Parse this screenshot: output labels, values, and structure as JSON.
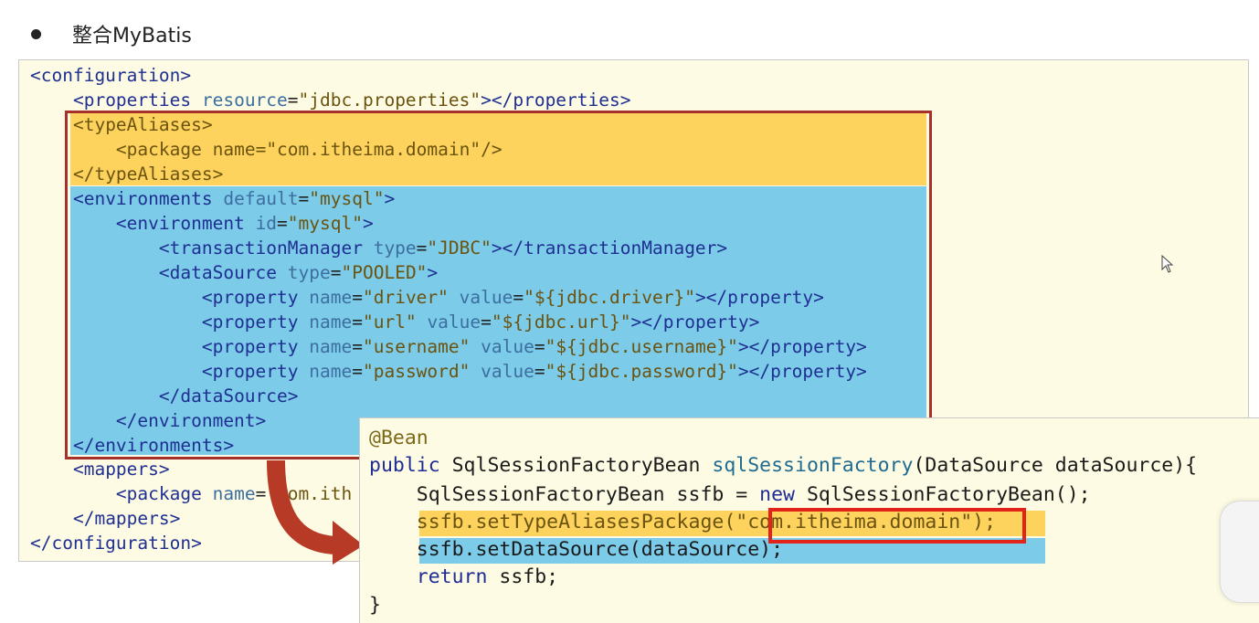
{
  "heading": {
    "text": "整合MyBatis"
  },
  "xml": {
    "config_open": "<configuration>",
    "properties_open": "<properties",
    "properties_attr": "resource",
    "properties_val": "\"jdbc.properties\"",
    "properties_close": "></properties>",
    "typealiases_open": "<typeAliases>",
    "package1_open": "<package",
    "package1_attr": "name",
    "package1_val": "\"com.itheima.domain\"",
    "package1_close": "/>",
    "typealiases_close": "</typeAliases>",
    "envs_open": "<environments",
    "envs_attr": "default",
    "envs_val": "\"mysql\"",
    "envs_close": ">",
    "env_open": "<environment",
    "env_attr": "id",
    "env_val": "\"mysql\"",
    "env_close": ">",
    "tm_open": "<transactionManager",
    "tm_attr": "type",
    "tm_val": "\"JDBC\"",
    "tm_close": "></transactionManager>",
    "ds_open": "<dataSource",
    "ds_attr": "type",
    "ds_val": "\"POOLED\"",
    "ds_close": ">",
    "properties_list": [
      {
        "open": "<property",
        "n": "name",
        "nv": "\"driver\"",
        "v": "value",
        "vv": "\"${jdbc.driver}\"",
        "close": "></property>"
      },
      {
        "open": "<property",
        "n": "name",
        "nv": "\"url\"",
        "v": "value",
        "vv": "\"${jdbc.url}\"",
        "close": "></property>"
      },
      {
        "open": "<property",
        "n": "name",
        "nv": "\"username\"",
        "v": "value",
        "vv": "\"${jdbc.username}\"",
        "close": "></property>"
      },
      {
        "open": "<property",
        "n": "name",
        "nv": "\"password\"",
        "v": "value",
        "vv": "\"${jdbc.password}\"",
        "close": "></property>"
      }
    ],
    "ds_end": "</dataSource>",
    "env_end": "</environment>",
    "envs_end": "</environments>",
    "mappers_open": "<mappers>",
    "package2_open": "<package",
    "package2_attr": "name",
    "package2_val": "\"com.ith",
    "mappers_close": "</mappers>",
    "config_close": "</configuration>"
  },
  "java": {
    "annotation": "@Bean",
    "l2_kw": "public",
    "l2_type": " SqlSessionFactoryBean ",
    "l2_fn": "sqlSessionFactory",
    "l2_rest": "(DataSource dataSource){",
    "l3_a": "SqlSessionFactoryBean ssfb = ",
    "l3_kw": "new",
    "l3_b": " SqlSessionFactoryBean();",
    "l4_a": "ssfb.setTypeAliasesPackage(",
    "l4_str": "\"com.itheima.domain\"",
    "l4_b": ");",
    "l5": "ssfb.setDataSource(dataSource);",
    "l6_kw": "return",
    "l6_rest": " ssfb;",
    "l7": "}"
  },
  "colors": {
    "panel_bg": "#fdfbe3",
    "highlight_yellow": "#fdd35d",
    "highlight_blue": "#7bcbe9",
    "frame_red": "#a6312a",
    "box_red": "#e2231a",
    "arrow_red": "#b73a26"
  }
}
